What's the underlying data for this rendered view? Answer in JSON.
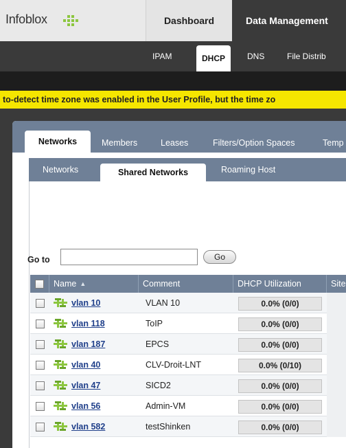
{
  "app": {
    "logo_text": "Infoblox"
  },
  "top_nav": {
    "dashboard": "Dashboard",
    "data_management": "Data Management"
  },
  "sub_nav": {
    "ipam": "IPAM",
    "dhcp": "DHCP",
    "dns": "DNS",
    "file_distribution": "File Distrib"
  },
  "warning": {
    "text": "to-detect time zone was enabled in the User Profile, but the time zo"
  },
  "panel_tabs": {
    "networks": "Networks",
    "members": "Members",
    "leases": "Leases",
    "filters": "Filters/Option Spaces",
    "templates": "Temp"
  },
  "sub_tabs": {
    "networks": "Networks",
    "shared_networks": "Shared Networks",
    "roaming_hosts": "Roaming Host"
  },
  "goto": {
    "label": "Go to",
    "button": "Go",
    "value": ""
  },
  "table": {
    "headers": {
      "name": "Name",
      "comment": "Comment",
      "dhcp_utilization": "DHCP Utilization",
      "site": "Site"
    },
    "rows": [
      {
        "name": "vlan 10",
        "comment": "VLAN 10",
        "util": "0.0% (0/0)"
      },
      {
        "name": "vlan 118",
        "comment": "ToIP",
        "util": "0.0% (0/0)"
      },
      {
        "name": "vlan 187",
        "comment": "EPCS",
        "util": "0.0% (0/0)"
      },
      {
        "name": "vlan 40",
        "comment": "CLV-Droit-LNT",
        "util": "0.0% (0/10)"
      },
      {
        "name": "vlan 47",
        "comment": "SICD2",
        "util": "0.0% (0/0)"
      },
      {
        "name": "vlan 56",
        "comment": "Admin-VM",
        "util": "0.0% (0/0)"
      },
      {
        "name": "vlan 582",
        "comment": "testShinken",
        "util": "0.0% (0/0)"
      }
    ]
  },
  "colors": {
    "accent_dark": "#3a3a3a",
    "warning_yellow": "#f5e600",
    "table_header": "#6f8097",
    "logo_green": "#8cc63f"
  }
}
